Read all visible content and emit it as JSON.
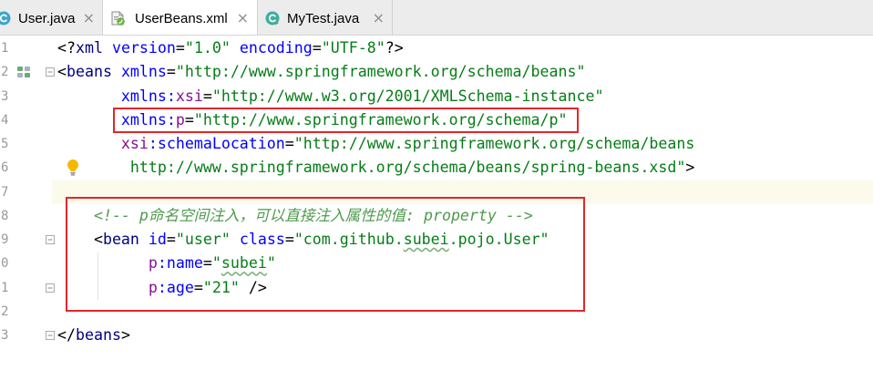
{
  "colors": {
    "tag": "#000080",
    "attr": "#0000FF",
    "ns": "#871094",
    "value": "#067D17",
    "comment": "#4E9A4E",
    "punct": "#000000",
    "current_line": "#FCFAEA",
    "annotation": "#E0262B"
  },
  "tabs": [
    {
      "label": "User.java",
      "icon": "class-icon",
      "active": false
    },
    {
      "label": "UserBeans.xml",
      "icon": "spring-xml-icon",
      "active": true
    },
    {
      "label": "MyTest.java",
      "icon": "test-class-icon",
      "active": false
    }
  ],
  "tab_close": "×",
  "editor": {
    "lines": [
      {
        "num": "1",
        "tokens": [
          {
            "t": "<?",
            "c": "#000000"
          },
          {
            "t": "xml",
            "c": "#000080"
          },
          {
            "t": " version",
            "c": "#0000FF"
          },
          {
            "t": "=",
            "c": "#000000"
          },
          {
            "t": "\"1.0\"",
            "c": "#067D17"
          },
          {
            "t": " encoding",
            "c": "#0000FF"
          },
          {
            "t": "=",
            "c": "#000000"
          },
          {
            "t": "\"UTF-8\"",
            "c": "#067D17"
          },
          {
            "t": "?>",
            "c": "#000000"
          }
        ]
      },
      {
        "num": "2",
        "gutter_icon": "spring-bean-icon",
        "fold_start": true,
        "tokens": [
          {
            "t": "<",
            "c": "#000000"
          },
          {
            "t": "beans",
            "c": "#000080"
          },
          {
            "t": " xmlns",
            "c": "#0000FF"
          },
          {
            "t": "=",
            "c": "#000000"
          },
          {
            "t": "\"http://www.springframework.org/schema/beans\"",
            "c": "#067D17"
          }
        ]
      },
      {
        "num": "3",
        "tokens": [
          {
            "t": "       xmlns:",
            "c": "#0000FF"
          },
          {
            "t": "xsi",
            "c": "#871094"
          },
          {
            "t": "=",
            "c": "#000000"
          },
          {
            "t": "\"http://www.w3.org/2001/XMLSchema-instance\"",
            "c": "#067D17"
          }
        ]
      },
      {
        "num": "4",
        "tokens": [
          {
            "t": "       xmlns:",
            "c": "#0000FF"
          },
          {
            "t": "p",
            "c": "#871094"
          },
          {
            "t": "=",
            "c": "#000000"
          },
          {
            "t": "\"http://www.springframework.org/schema/p\"",
            "c": "#067D17"
          }
        ]
      },
      {
        "num": "5",
        "tokens": [
          {
            "t": "       xsi",
            "c": "#871094"
          },
          {
            "t": ":schemaLocation",
            "c": "#0000FF"
          },
          {
            "t": "=",
            "c": "#000000"
          },
          {
            "t": "\"http://www.springframework.org/schema/beans",
            "c": "#067D17"
          }
        ]
      },
      {
        "num": "6",
        "intention_icon": "lightbulb-icon",
        "tokens": [
          {
            "t": "        http://www.springframework.org/schema/beans/spring-beans.xsd\"",
            "c": "#067D17"
          },
          {
            "t": ">",
            "c": "#000000"
          }
        ]
      },
      {
        "num": "7",
        "current": true,
        "tokens": []
      },
      {
        "num": "8",
        "tokens": [
          {
            "t": "    <!-- p命名空间注入，可以直接注入属性的值: property -->",
            "c": "#4E9A4E",
            "i": true
          }
        ]
      },
      {
        "num": "9",
        "fold_start": true,
        "tokens": [
          {
            "t": "    <",
            "c": "#000000"
          },
          {
            "t": "bean",
            "c": "#000080"
          },
          {
            "t": " id",
            "c": "#0000FF"
          },
          {
            "t": "=",
            "c": "#000000"
          },
          {
            "t": "\"user\"",
            "c": "#067D17"
          },
          {
            "t": " class",
            "c": "#0000FF"
          },
          {
            "t": "=",
            "c": "#000000"
          },
          {
            "t": "\"com.github.",
            "c": "#067D17"
          },
          {
            "t": "subei",
            "c": "#067D17",
            "u": true
          },
          {
            "t": ".pojo.User\"",
            "c": "#067D17"
          }
        ]
      },
      {
        "num": "0",
        "tokens": [
          {
            "t": "          p",
            "c": "#871094"
          },
          {
            "t": ":name",
            "c": "#0000FF"
          },
          {
            "t": "=",
            "c": "#000000"
          },
          {
            "t": "\"",
            "c": "#067D17"
          },
          {
            "t": "subei",
            "c": "#067D17",
            "u": true
          },
          {
            "t": "\"",
            "c": "#067D17"
          }
        ]
      },
      {
        "num": "1",
        "fold_end": true,
        "tokens": [
          {
            "t": "          p",
            "c": "#871094"
          },
          {
            "t": ":age",
            "c": "#0000FF"
          },
          {
            "t": "=",
            "c": "#000000"
          },
          {
            "t": "\"21\"",
            "c": "#067D17"
          },
          {
            "t": " />",
            "c": "#000000"
          }
        ]
      },
      {
        "num": "2",
        "tokens": []
      },
      {
        "num": "3",
        "fold_end": true,
        "tokens": [
          {
            "t": "</",
            "c": "#000000"
          },
          {
            "t": "beans",
            "c": "#000080"
          },
          {
            "t": ">",
            "c": "#000000"
          }
        ]
      }
    ]
  }
}
